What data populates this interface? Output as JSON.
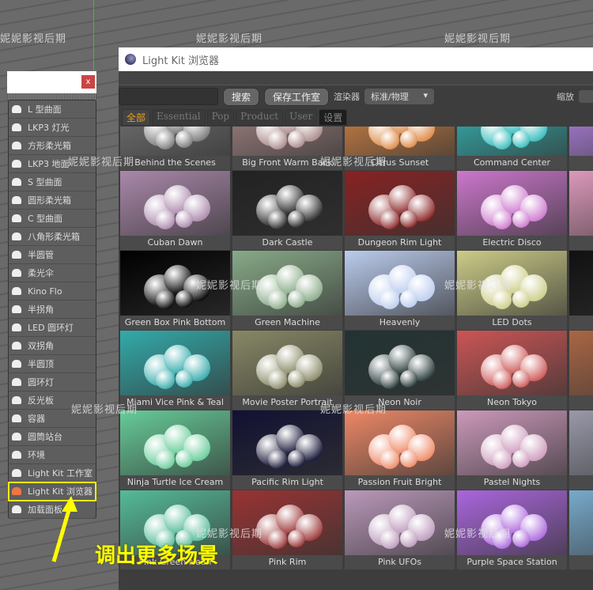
{
  "popup": {
    "close": "x",
    "items": [
      {
        "label": "L 型曲面"
      },
      {
        "label": "LKP3 灯光"
      },
      {
        "label": "方形柔光箱"
      },
      {
        "label": "LKP3 地面"
      },
      {
        "label": "S 型曲面"
      },
      {
        "label": "圆形柔光箱"
      },
      {
        "label": "C 型曲面"
      },
      {
        "label": "八角形柔光箱"
      },
      {
        "label": "半圆管"
      },
      {
        "label": "柔光伞"
      },
      {
        "label": "Kino Flo"
      },
      {
        "label": "半拐角"
      },
      {
        "label": "LED 圆环灯"
      },
      {
        "label": "双拐角"
      },
      {
        "label": "半圆顶"
      },
      {
        "label": "圆环灯"
      },
      {
        "label": "反光板"
      },
      {
        "label": "容器"
      },
      {
        "label": "圆筒站台"
      },
      {
        "label": "环境"
      },
      {
        "label": "Light Kit 工作室"
      },
      {
        "label": "Light Kit 浏览器",
        "selected": true
      },
      {
        "label": "加载面板"
      }
    ]
  },
  "window": {
    "title": "Light Kit 浏览器",
    "search_placeholder": "",
    "search_button": "搜索",
    "save_button": "保存工作室",
    "renderer_label": "渲染器",
    "renderer_value": "标准/物理",
    "zoom_label": "缩放",
    "tabs": [
      {
        "label": "全部",
        "active": true
      },
      {
        "label": "Essential"
      },
      {
        "label": "Pop"
      },
      {
        "label": "Product"
      },
      {
        "label": "User"
      },
      {
        "label": "设置"
      }
    ],
    "presets": [
      [
        "Behind the Scenes",
        "Big Front Warm Back",
        "Citrus Sunset",
        "Command Center",
        "Cotton"
      ],
      [
        "Cuban Dawn",
        "Dark Castle",
        "Dungeon Rim Light",
        "Electric Disco",
        "Ga"
      ],
      [
        "Green Box Pink Bottom",
        "Green Machine",
        "Heavenly",
        "LED Dots",
        "L"
      ],
      [
        "Miami Vice Pink & Teal",
        "Movie Poster Portrait",
        "Neon Noir",
        "Neon Tokyo",
        ""
      ],
      [
        "Ninja Turtle Ice Cream",
        "Pacific Rim Light",
        "Passion Fruit Bright",
        "Pastel Nights",
        "Pi"
      ],
      [
        "Pink Green Neon",
        "Pink Rim",
        "Pink UFOs",
        "Purple Space Station",
        ""
      ]
    ],
    "colors": [
      [
        "#777",
        "#a88",
        "#d84",
        "#3bb",
        "#b8e"
      ],
      [
        "#a8a",
        "#222",
        "#822",
        "#c7c",
        "#d9b"
      ],
      [
        "#000",
        "#8a8",
        "#bce",
        "#cc8",
        "#111"
      ],
      [
        "#3aa",
        "#886",
        "#233",
        "#c55",
        "#a64"
      ],
      [
        "#6c9",
        "#113",
        "#e86",
        "#c9b",
        "#99a"
      ],
      [
        "#5b9",
        "#933",
        "#b9b",
        "#a6d",
        "#7ac"
      ]
    ]
  },
  "watermark": "妮妮影视后期",
  "annotation": "调出更多场景"
}
